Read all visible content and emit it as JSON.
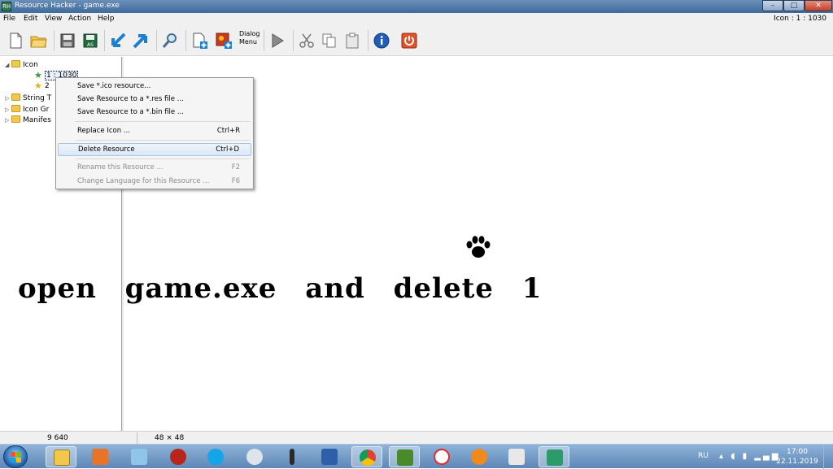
{
  "window": {
    "title": "Resource Hacker - game.exe",
    "app_icon_text": "RH",
    "controls": {
      "minimize": "–",
      "maximize": "□",
      "close": "✕"
    }
  },
  "menubar": {
    "items": [
      "File",
      "Edit",
      "View",
      "Action",
      "Help"
    ],
    "status_right": "Icon : 1 : 1030"
  },
  "toolbar": {
    "dialog_label": "Dialog Menu",
    "buttons": [
      "new-icon",
      "open-folder-icon",
      "save-icon",
      "save-as-icon",
      "compile-left-icon",
      "compile-right-icon",
      "search-icon",
      "add-resource-icon",
      "add-image-icon",
      "dialog-menu-icon",
      "play-icon",
      "cut-icon",
      "copy-icon",
      "paste-icon",
      "info-icon",
      "power-icon"
    ]
  },
  "tree": {
    "items": [
      {
        "label": "Icon",
        "expanded": true
      },
      {
        "label": "1 : 1030",
        "selected": true
      },
      {
        "label": "2"
      },
      {
        "label": "String T"
      },
      {
        "label": "Icon Gr"
      },
      {
        "label": "Manifes"
      }
    ]
  },
  "context_menu": {
    "items": [
      {
        "label": "Save *.ico resource...",
        "shortcut": "",
        "enabled": true
      },
      {
        "label": "Save Resource to a *.res file ...",
        "shortcut": "",
        "enabled": true
      },
      {
        "label": "Save Resource to a *.bin file ...",
        "shortcut": "",
        "enabled": true
      },
      {
        "label": "Replace Icon ...",
        "shortcut": "Ctrl+R",
        "enabled": true
      },
      {
        "label": "Delete Resource",
        "shortcut": "Ctrl+D",
        "enabled": true,
        "highlighted": true
      },
      {
        "label": "Rename this Resource ...",
        "shortcut": "F2",
        "enabled": false
      },
      {
        "label": "Change Language for this Resource ...",
        "shortcut": "F6",
        "enabled": false
      }
    ]
  },
  "overlay": {
    "caption": "open game.exe and delete 1",
    "paw_icon": "paw-icon"
  },
  "statusbar": {
    "left": "9 640",
    "size": "48 × 48"
  },
  "taskbar": {
    "apps": [
      "explorer-icon",
      "media-player-icon",
      "files-icon",
      "spider-icon",
      "skype-icon",
      "webcam-icon",
      "microphone-icon",
      "installer-icon",
      "chrome-icon",
      "game-icon",
      "yandex-browser-icon",
      "blender-icon",
      "paint-icon",
      "resource-hacker-icon"
    ],
    "lang": "RU",
    "time": "17:00",
    "date": "22.11.2019"
  },
  "colors": {
    "titlebar": "#4a76a8",
    "taskbar": "#6f98c6",
    "menu_highlight": "#dce8f8",
    "caption": "#000000"
  }
}
